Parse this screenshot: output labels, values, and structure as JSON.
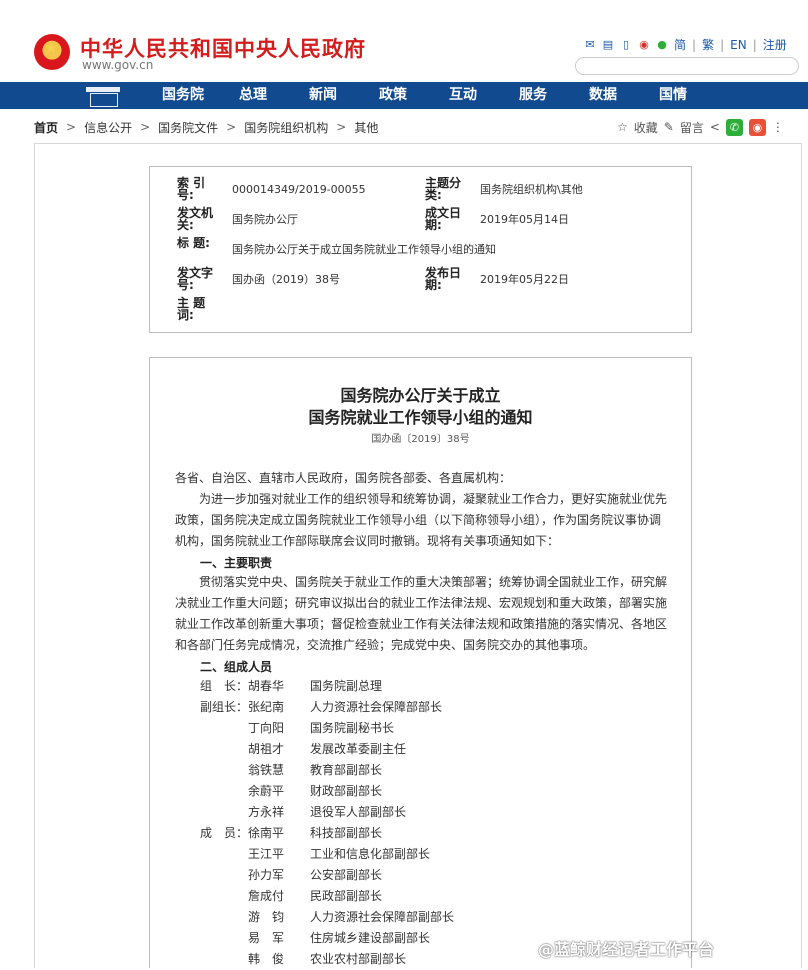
{
  "header": {
    "site_title": "中华人民共和国中央人民政府",
    "site_url": "www.gov.cn",
    "links": [
      "简",
      "繁",
      "EN",
      "注册"
    ],
    "icons": [
      "mail-icon",
      "message-icon",
      "mobile-icon",
      "weibo-icon",
      "wechat-icon"
    ]
  },
  "nav": {
    "items": [
      "国务院",
      "总理",
      "新闻",
      "政策",
      "互动",
      "服务",
      "数据",
      "国情"
    ]
  },
  "breadcrumb": {
    "items": [
      "首页",
      "信息公开",
      "国务院文件",
      "国务院组织机构",
      "其他"
    ],
    "favorite": "收藏",
    "comment": "留言"
  },
  "meta": {
    "suoyin_label": "索 引 号:",
    "suoyin": "000014349/2019-00055",
    "category_label": "主题分类:",
    "category": "国务院组织机构\\其他",
    "issuer_label": "发文机关:",
    "issuer": "国务院办公厅",
    "written_label": "成文日期:",
    "written": "2019年05月14日",
    "title_label": "标 题:",
    "title": "国务院办公厅关于成立国务院就业工作领导小组的通知",
    "docno_label": "发文字号:",
    "docno": "国办函（2019）38号",
    "published_label": "发布日期:",
    "published": "2019年05月22日",
    "keywords_label": "主 题 词:"
  },
  "document": {
    "title_line1": "国务院办公厅关于成立",
    "title_line2": "国务院就业工作领导小组的通知",
    "number": "国办函〔2019〕38号",
    "salutation": "各省、自治区、直辖市人民政府，国务院各部委、各直属机构：",
    "intro": "为进一步加强对就业工作的组织领导和统筹协调，凝聚就业工作合力，更好实施就业优先政策，国务院决定成立国务院就业工作领导小组（以下简称领导小组），作为国务院议事协调机构，国务院就业工作部际联席会议同时撤销。现将有关事项通知如下：",
    "section1": "一、主要职责",
    "duties": "贯彻落实党中央、国务院关于就业工作的重大决策部署；统筹协调全国就业工作，研究解决就业工作重大问题；研究审议拟出台的就业工作法律法规、宏观规划和重大政策，部署实施就业工作改革创新重大事项；督促检查就业工作有关法律法规和政策措施的落实情况、各地区和各部门任务完成情况，交流推广经验；完成党中央、国务院交办的其他事项。",
    "section2": "二、组成人员",
    "members": [
      {
        "role": "组　长：",
        "name": "胡春华",
        "title": "国务院副总理"
      },
      {
        "role": "副组长：",
        "name": "张纪南",
        "title": "人力资源社会保障部部长"
      },
      {
        "role": "",
        "name": "丁向阳",
        "title": "国务院副秘书长"
      },
      {
        "role": "",
        "name": "胡祖才",
        "title": "发展改革委副主任"
      },
      {
        "role": "",
        "name": "翁铁慧",
        "title": "教育部副部长"
      },
      {
        "role": "",
        "name": "余蔚平",
        "title": "财政部副部长"
      },
      {
        "role": "",
        "name": "方永祥",
        "title": "退役军人部副部长"
      },
      {
        "role": "成　员：",
        "name": "徐南平",
        "title": "科技部副部长"
      },
      {
        "role": "",
        "name": "王江平",
        "title": "工业和信息化部副部长"
      },
      {
        "role": "",
        "name": "孙力军",
        "title": "公安部副部长"
      },
      {
        "role": "",
        "name": "詹成付",
        "title": "民政部副部长"
      },
      {
        "role": "",
        "name": "游　钧",
        "title": "人力资源社会保障部副部长"
      },
      {
        "role": "",
        "name": "易　军",
        "title": "住房城乡建设部副部长"
      },
      {
        "role": "",
        "name": "韩　俊",
        "title": "农业农村部副部长"
      }
    ]
  },
  "watermark": "@蓝鲸财经记者工作平台"
}
